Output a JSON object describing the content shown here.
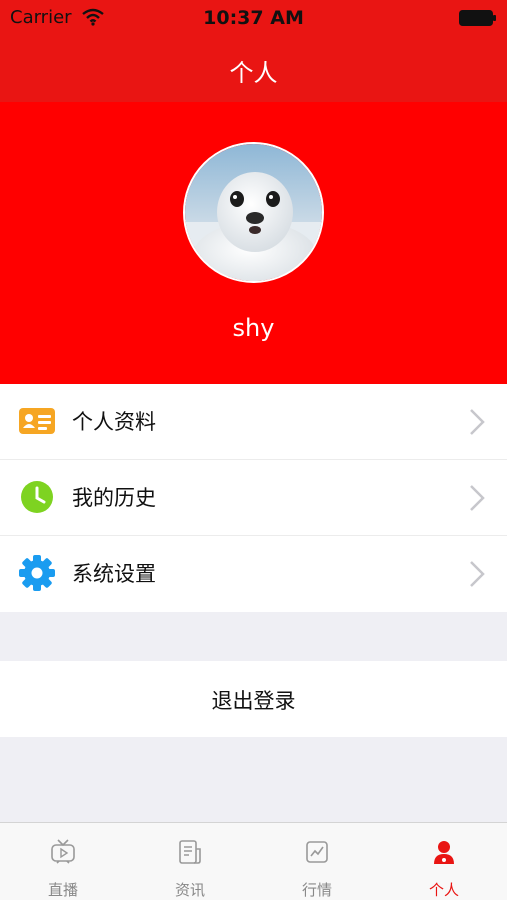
{
  "status_bar": {
    "carrier": "Carrier",
    "time": "10:37 AM"
  },
  "nav": {
    "title": "个人"
  },
  "profile": {
    "username": "shy",
    "avatar_icon": "seal-avatar-photo"
  },
  "menu": {
    "items": [
      {
        "label": "个人资料",
        "icon": "id-card-icon",
        "color": "#f6a623"
      },
      {
        "label": "我的历史",
        "icon": "clock-icon",
        "color": "#7ed321"
      },
      {
        "label": "系统设置",
        "icon": "gear-icon",
        "color": "#1a9cf0"
      }
    ]
  },
  "logout": {
    "label": "退出登录"
  },
  "tabbar": {
    "tabs": [
      {
        "label": "直播",
        "icon": "tv-icon"
      },
      {
        "label": "资讯",
        "icon": "news-icon"
      },
      {
        "label": "行情",
        "icon": "chart-icon"
      },
      {
        "label": "个人",
        "icon": "person-icon",
        "active": true
      }
    ]
  },
  "colors": {
    "nav_red": "#e91513",
    "profile_red": "#ff0000",
    "active_tab": "#e91513"
  }
}
